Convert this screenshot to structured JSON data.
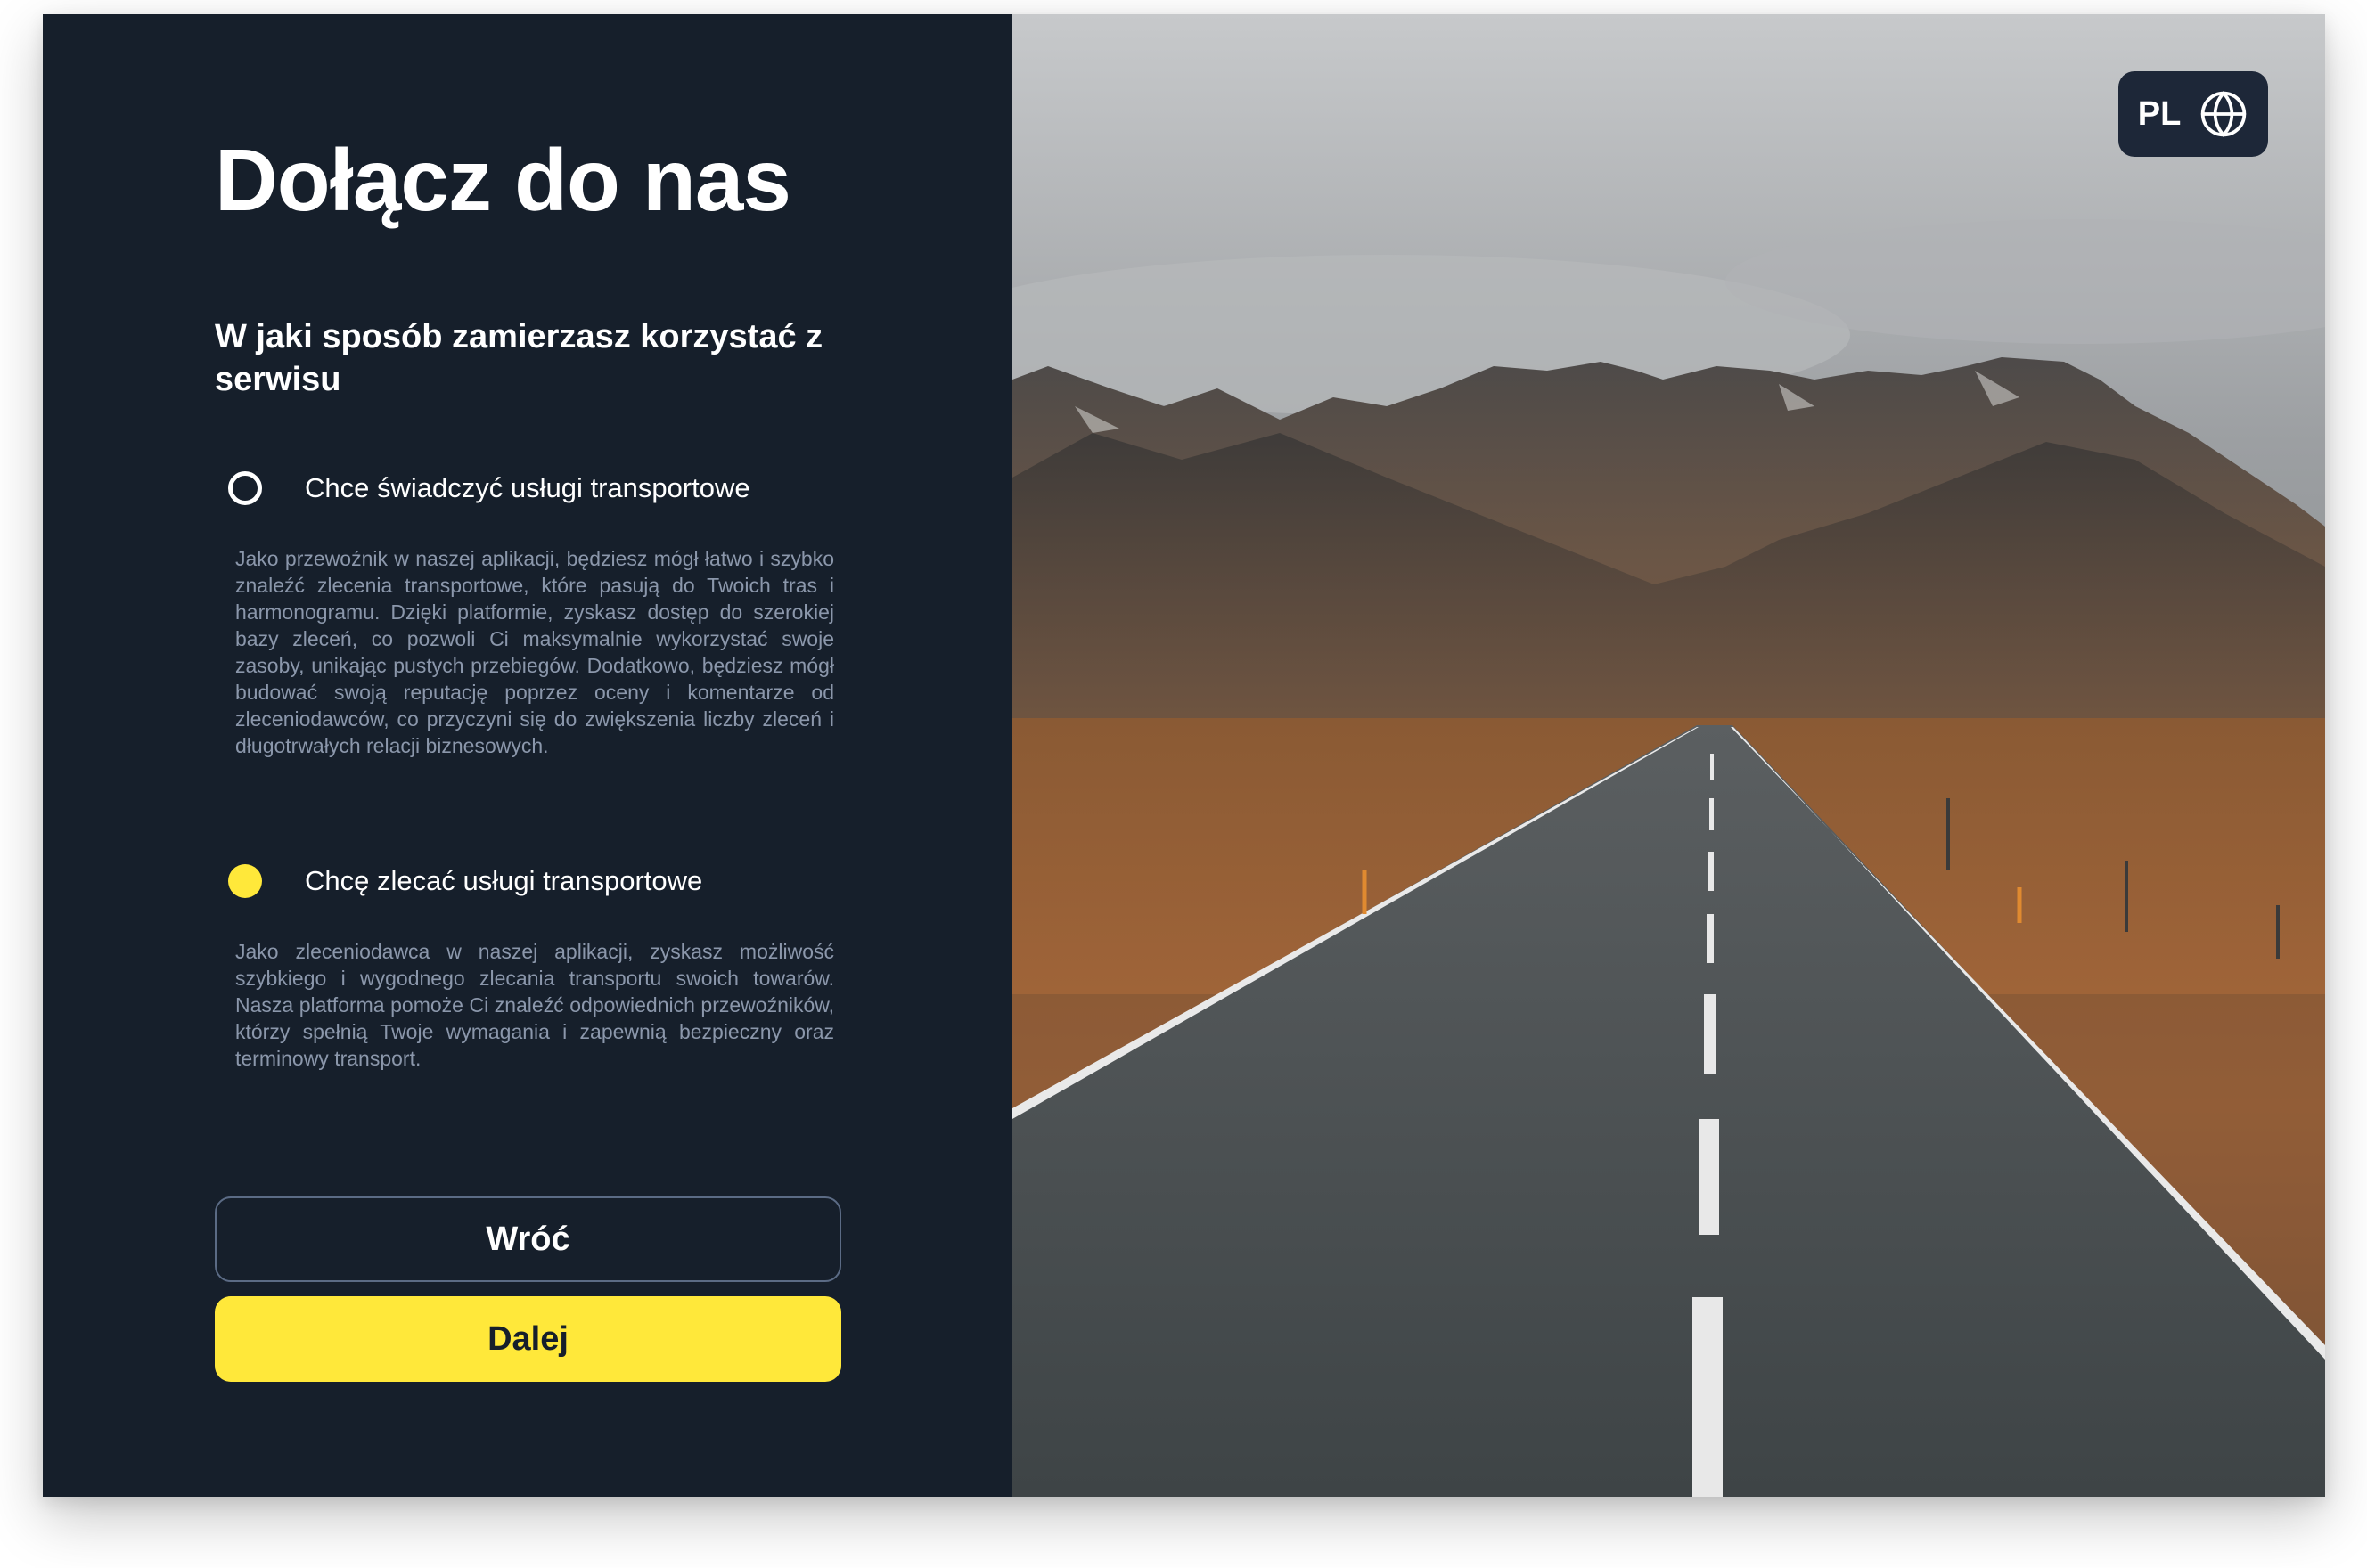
{
  "page": {
    "title": "Dołącz do nas",
    "question": "W jaki sposób zamierzasz korzystać z serwisu"
  },
  "options": [
    {
      "label": "Chce świadczyć usługi transportowe",
      "description": "Jako przewoźnik w naszej aplikacji, będziesz mógł łatwo i szybko znaleźć zlecenia transportowe, które pasują do Twoich tras i harmonogramu. Dzięki platformie, zyskasz dostęp do szerokiej bazy zleceń, co pozwoli Ci maksymalnie wykorzystać swoje zasoby, unikając pustych przebiegów. Dodatkowo, będziesz mógł budować swoją reputację poprzez oceny i komentarze od zleceniodawców, co przyczyni się do zwiększenia liczby zleceń i długotrwałych relacji biznesowych.",
      "selected": false
    },
    {
      "label": "Chcę zlecać usługi transportowe",
      "description": "Jako zleceniodawca w naszej aplikacji, zyskasz możliwość szybkiego i wygodnego zlecania transportu swoich towarów. Nasza platforma pomoże Ci znaleźć odpowiednich przewoźników, którzy spełnią Twoje wymagania i zapewnią bezpieczny oraz terminowy transport.",
      "selected": true
    }
  ],
  "buttons": {
    "back": "Wróć",
    "next": "Dalej"
  },
  "language": {
    "code": "PL",
    "icon": "globe-icon"
  },
  "colors": {
    "panel_background": "#161f2b",
    "accent": "#ffe83a",
    "muted_text": "#8b97ab",
    "button_border": "#5b6b85"
  }
}
